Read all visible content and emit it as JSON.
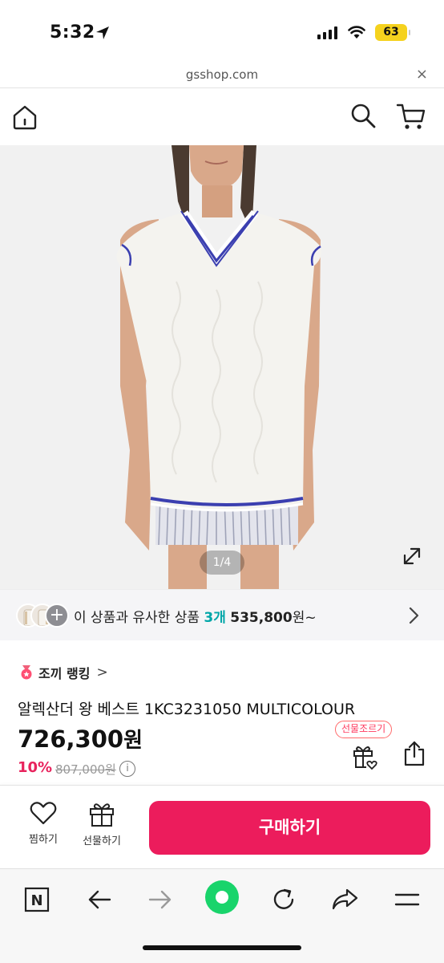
{
  "status_bar": {
    "time": "5:32",
    "battery": "63",
    "icons": [
      "location-arrow-icon",
      "cellular-signal-icon",
      "wifi-icon",
      "battery-icon"
    ]
  },
  "browser": {
    "url": "gsshop.com",
    "close_icon": "×"
  },
  "header": {
    "icons": [
      "home-icon",
      "search-icon",
      "cart-icon"
    ]
  },
  "gallery": {
    "pager": "1/4",
    "expand_icon": "expand-icon",
    "colors": {
      "background": "#f1f1f1",
      "vest": "#f4f3ef",
      "trim_blue": "#3b3fb0"
    }
  },
  "similar": {
    "text_prefix": "이 상품과 유사한 상품",
    "count": "3개",
    "price": "535,800",
    "price_suffix": "원~",
    "plus_icon": "+"
  },
  "product": {
    "ranking_label": "조끼 랭킹",
    "ranking_arrow": ">",
    "name": "알렉산더 왕 베스트 1KC3231050 MULTICOLOUR",
    "price": "726,300",
    "price_unit": "원",
    "discount": "10%",
    "original_price": "807,000원",
    "info_icon": "i",
    "gift_tag": "선물조르기"
  },
  "purchase_bar": {
    "wish_label": "찜하기",
    "gift_label": "선물하기",
    "buy_label": "구매하기"
  },
  "toolbar": {
    "n_label": "N",
    "icons": [
      "naver-n-icon",
      "back-arrow-icon",
      "forward-arrow-icon",
      "green-dot-icon",
      "reload-icon",
      "share-arrow-icon",
      "menu-icon"
    ]
  },
  "colors": {
    "accent_pink": "#ec1c5c",
    "teal": "#00a6a8",
    "discount_red": "#e8235d",
    "green_button": "#19d46b"
  }
}
